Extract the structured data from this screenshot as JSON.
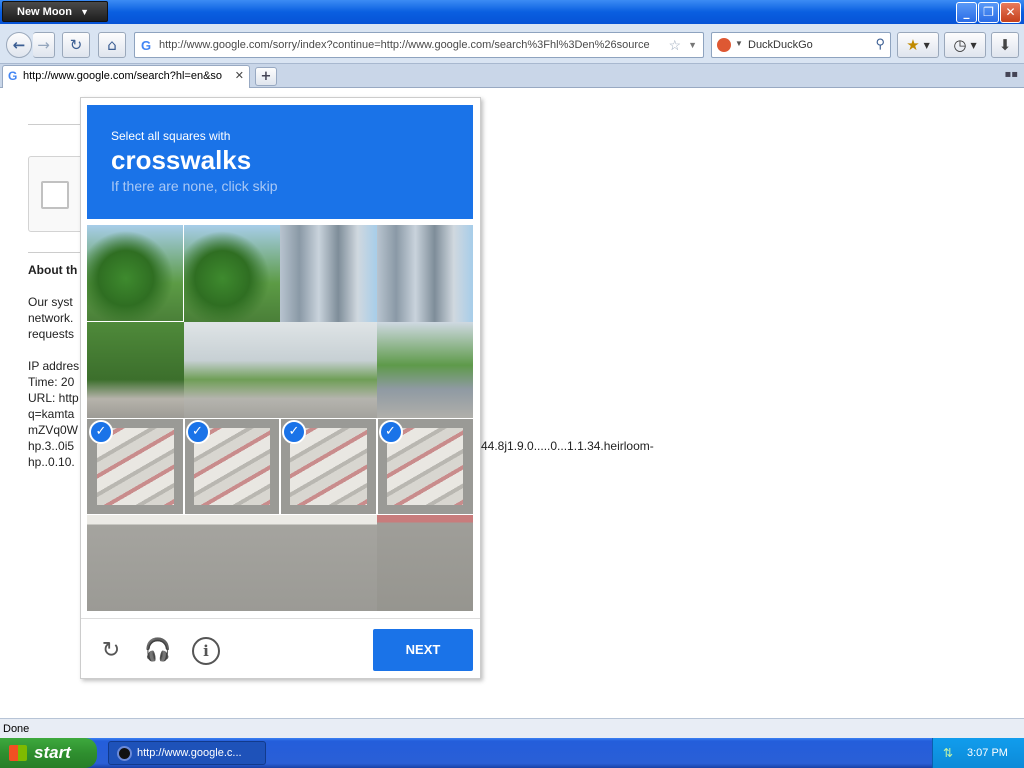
{
  "window": {
    "app_button": "New Moon",
    "controls": [
      "minimize",
      "restore",
      "close"
    ]
  },
  "nav": {
    "url": "http://www.google.com/sorry/index?continue=http://www.google.com/search%3Fhl%3Den%26source",
    "search_engine": "DuckDuckGo",
    "search_placeholder": "DuckDuckGo"
  },
  "tabs": [
    {
      "label": "http://www.google.com/search?hl=en&so",
      "active": true
    }
  ],
  "page": {
    "heading": "About th",
    "para_lines": [
      "Our syst",
      "network.",
      "requests"
    ],
    "info_lines": [
      "IP addres",
      "Time: 20",
      "URL: http",
      "q=kamta",
      "mZVq0W",
      "hp.3..0i5",
      "hp..0.10."
    ],
    "trailing_text": "44.8j1.9.0.....0...1.1.34.heirloom-"
  },
  "captcha": {
    "instruction": "Select all squares with",
    "target": "crosswalks",
    "hint": "If there are none, click skip",
    "grid_size": 4,
    "selected_tiles": [
      [
        2,
        0
      ],
      [
        2,
        1
      ],
      [
        2,
        2
      ],
      [
        2,
        3
      ]
    ],
    "next_label": "NEXT",
    "footer_icons": [
      "reload-icon",
      "headphones-icon",
      "info-icon"
    ]
  },
  "status": {
    "text": "Done"
  },
  "taskbar": {
    "start_label": "start",
    "window_item": "http://www.google.c...",
    "clock": "3:07 PM"
  },
  "colors": {
    "captcha_blue": "#1a73e8",
    "xp_taskbar": "#245edb",
    "start_green": "#3ea93e"
  }
}
